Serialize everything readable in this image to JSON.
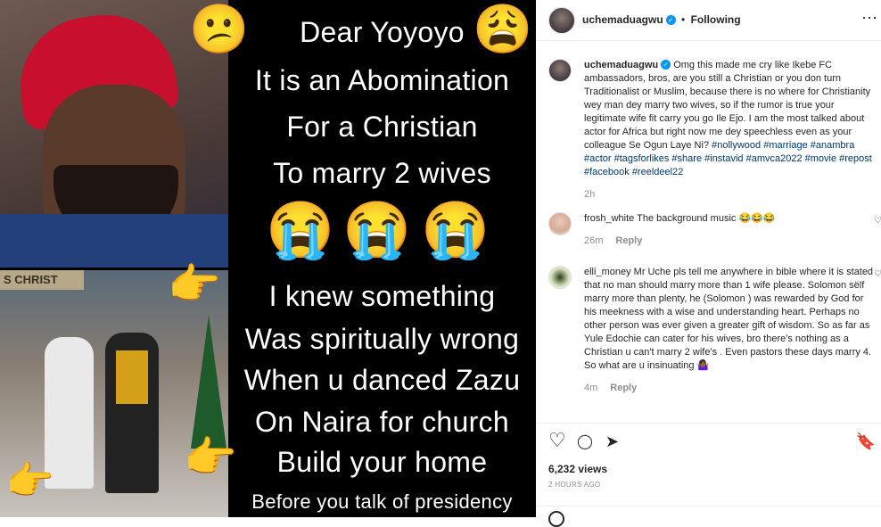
{
  "post": {
    "image_lines": [
      "Dear Yoyoyo",
      "It is an Abomination",
      "For a Christian",
      "To marry 2 wives",
      "I knew something",
      "Was spiritually wrong",
      "When u danced Zazu",
      "On Naira for church",
      "Build your home",
      "Before you talk of presidency"
    ],
    "banner_text": "S CHRIST",
    "emojis": {
      "sad": "😕",
      "annoyed": "😩",
      "crying": "😭",
      "point_right": "👉"
    }
  },
  "header": {
    "username": "uchemaduagwu",
    "dot": "•",
    "follow_status": "Following",
    "more": "⋯"
  },
  "caption": {
    "username": "uchemaduagwu",
    "text": "Omg this made me cry like Ikebe FC ambassadors, bros, are you still a Christian or you don turn Traditionalist or Muslim, because there is no where for Christianity wey man dey marry two wives, so if the rumor is true your legitimate wife fit carry you go Ile Ejo. I am the most talked about actor for Africa but right now me dey speechless even as your colleague Se Ogun Laye Ni?",
    "hashtags": "#nollywood #marriage #anambra #actor #tagsforlikes #share #instavid #amvca2022 #movie #repost #facebook #reeldeel22",
    "time": "2h"
  },
  "comments": [
    {
      "username": "frosh_white",
      "text": "The background music 😂😂😂",
      "time": "26m",
      "reply": "Reply"
    },
    {
      "username": "elli_money",
      "text": "Mr Uche pls tell me anywhere in bible where it is stated that no man should marry more than 1 wife please. Solomon sëlf marry more than plenty, he (Solomon ) was rewarded by God for his meekness with a wise and understanding heart. Perhaps no other person was ever given a greater gift of wisdom. So as far as Yule Edochie can cater for his wives, bro there's nothing as a Christian u can't marry 2 wife's . Even pastors these days marry 4. So what are u insinuating 🤷🏾‍♀️",
      "time": "4m",
      "reply": "Reply"
    }
  ],
  "actions": {
    "like": "♡",
    "comment": "◯",
    "share": "➤",
    "save": "🔖",
    "views": "6,232 views",
    "date": "2 HOURS AGO"
  }
}
